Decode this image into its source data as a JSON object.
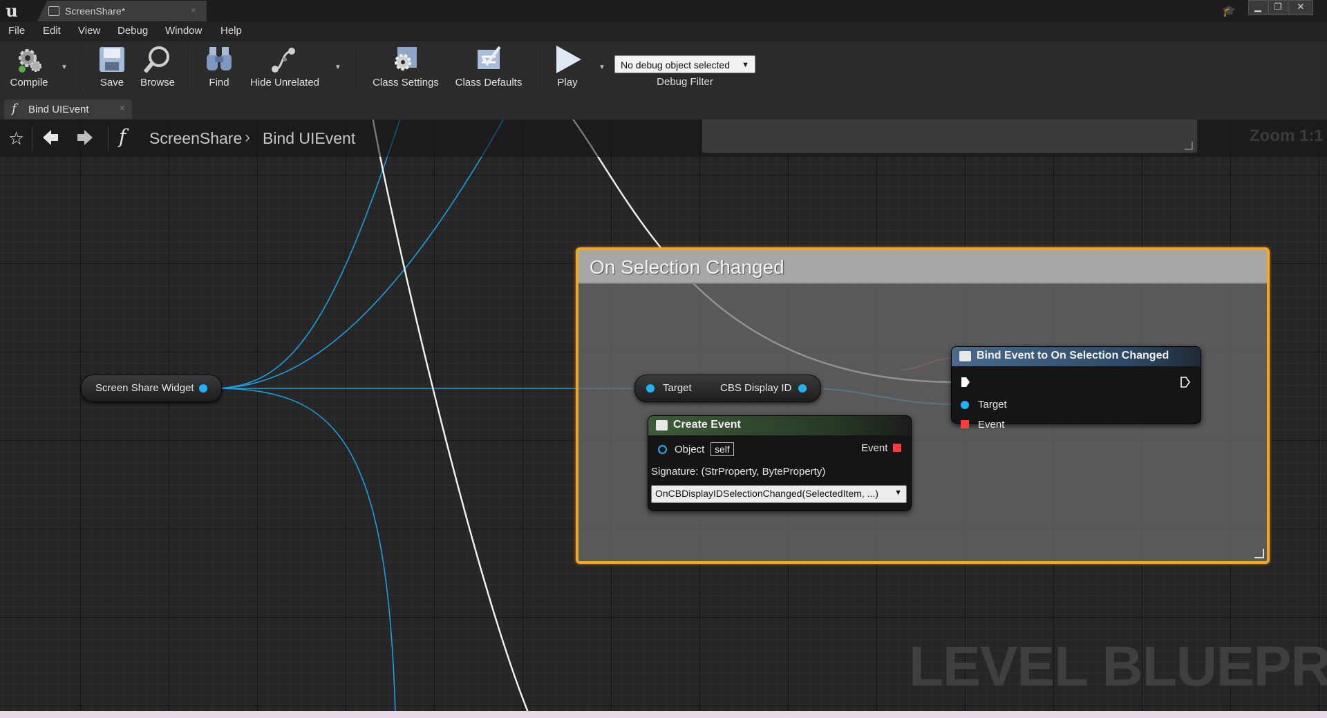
{
  "window": {
    "tab_title": "ScreenShare*",
    "tab_close": "×",
    "controls": {
      "minimize": "▁",
      "restore": "❐",
      "close": "✕"
    }
  },
  "menu": [
    "File",
    "Edit",
    "View",
    "Debug",
    "Window",
    "Help"
  ],
  "toolbar": {
    "compile": "Compile",
    "save": "Save",
    "browse": "Browse",
    "find": "Find",
    "hide_unrelated": "Hide Unrelated",
    "class_settings": "Class Settings",
    "class_defaults": "Class Defaults",
    "play": "Play",
    "debug_object": "No debug object selected",
    "debug_filter": "Debug Filter"
  },
  "function_tab": {
    "label": "Bind UIEvent",
    "icon": "function-icon"
  },
  "breadcrumb": {
    "root": "ScreenShare",
    "separator": "›",
    "leaf": "Bind UIEvent"
  },
  "graph": {
    "zoom": "Zoom 1:1",
    "watermark": "LEVEL BLUEPRINT",
    "comment_title": "On Selection Changed",
    "pin_colors": {
      "object": "#1db3ff",
      "delegate": "#ff3b3b",
      "exec": "#ffffff"
    }
  },
  "nodes": {
    "screen_share_widget": {
      "label": "Screen Share Widget"
    },
    "cbs_display_id": {
      "input": "Target",
      "output": "CBS Display ID"
    },
    "create_event": {
      "title": "Create Event",
      "object_pin": "Object",
      "object_value": "self",
      "event_pin": "Event",
      "signature": "Signature: (StrProperty, ByteProperty)",
      "function": "OnCBDisplayIDSelectionChanged(SelectedItem, ...)"
    },
    "bind_event": {
      "title": "Bind Event to On Selection Changed",
      "target_pin": "Target",
      "event_pin": "Event"
    }
  }
}
